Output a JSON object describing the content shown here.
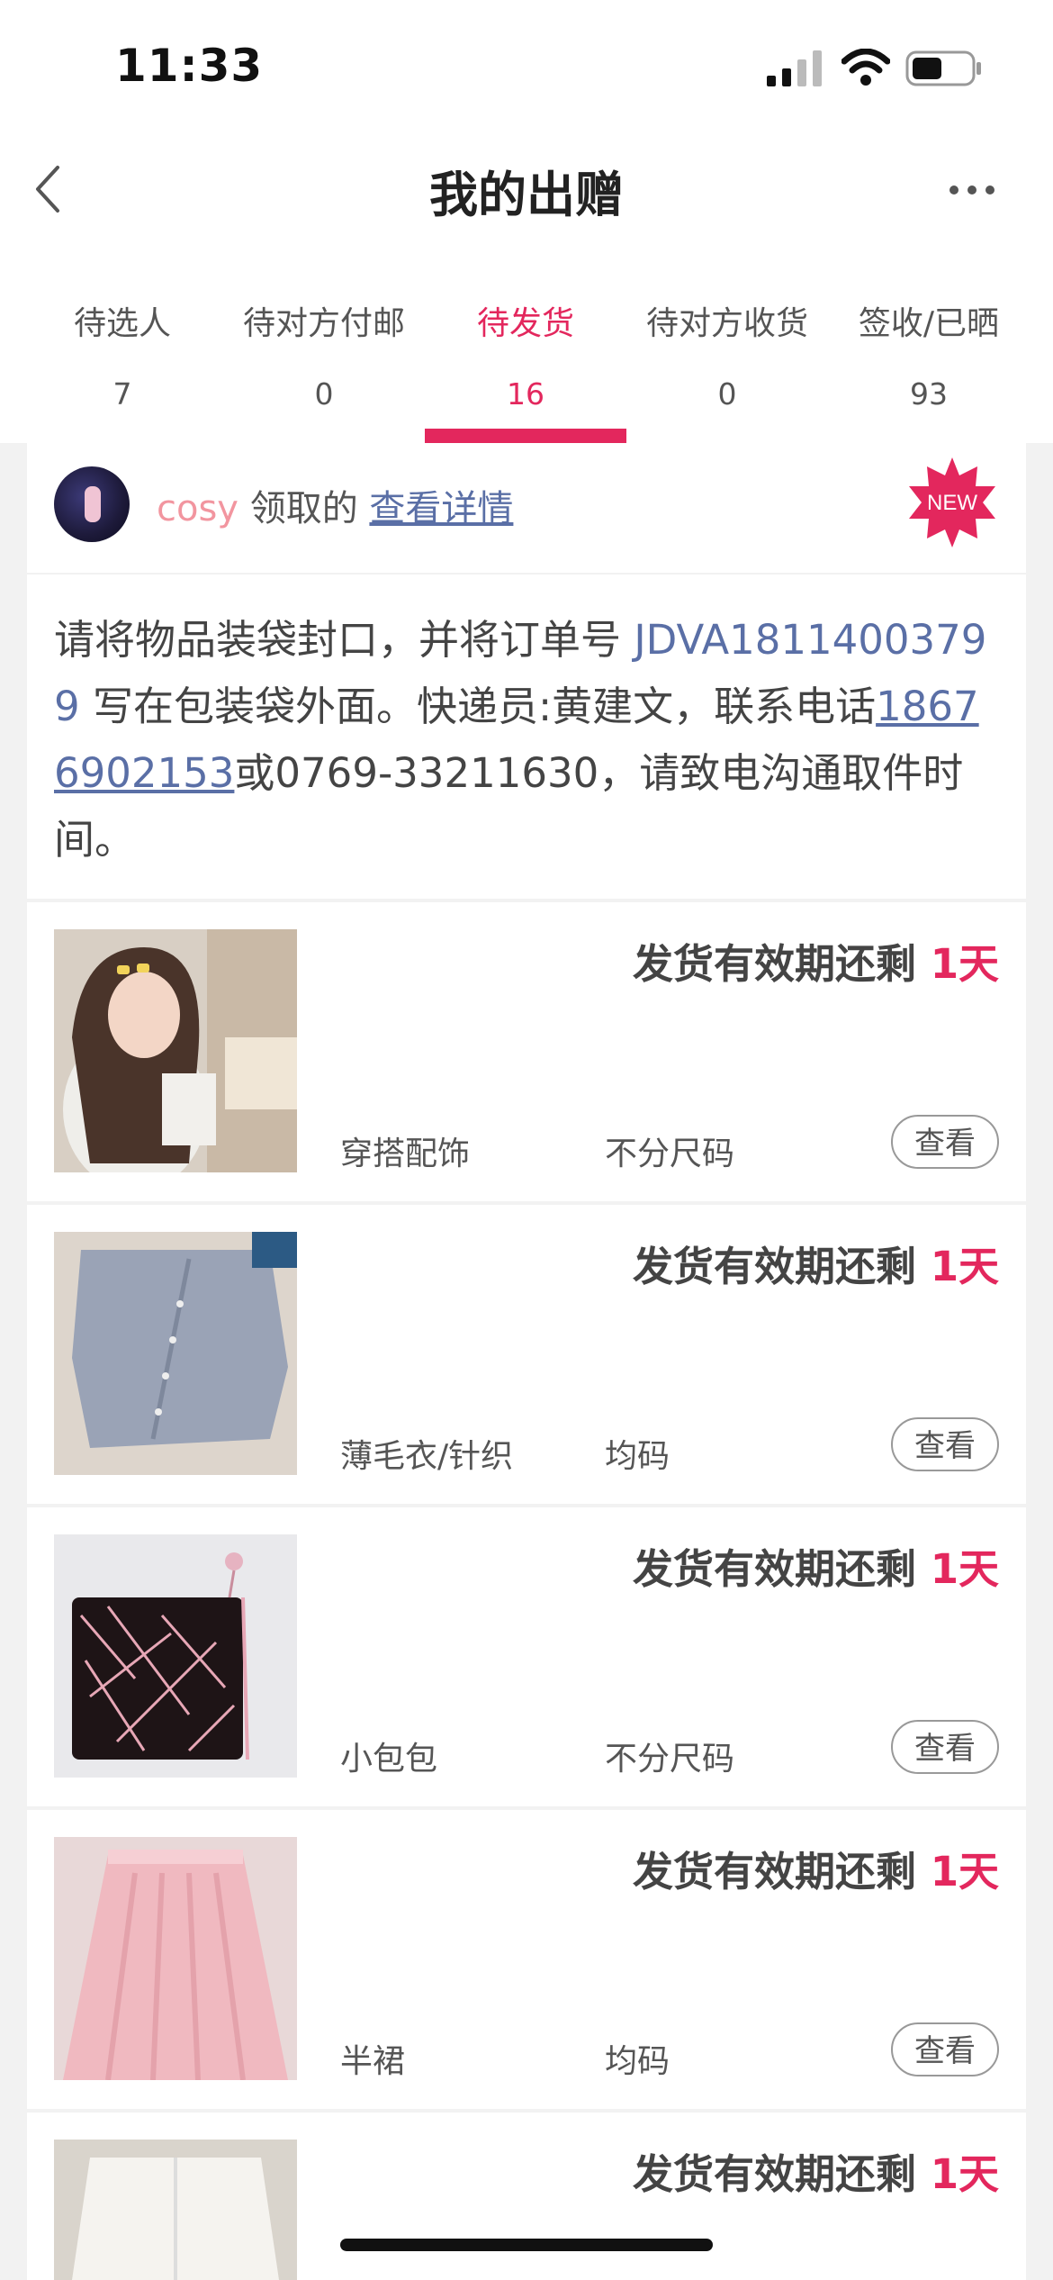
{
  "status_bar": {
    "time": "11:33"
  },
  "header": {
    "title": "我的出赠"
  },
  "tabs": [
    {
      "label": "待选人",
      "count": "7"
    },
    {
      "label": "待对方付邮",
      "count": "0"
    },
    {
      "label": "待发货",
      "count": "16",
      "active": true
    },
    {
      "label": "待对方收货",
      "count": "0"
    },
    {
      "label": "签收/已晒",
      "count": "93"
    }
  ],
  "recipient": {
    "name": "cosy",
    "claimed_text": "领取的",
    "detail_link": "查看详情",
    "badge": "NEW"
  },
  "instructions": {
    "part1": "请将物品装袋封口，并将订单号 ",
    "order_no": "JDVA18114003799",
    "part2": " 写在包装袋外面。快递员:黄建文，联系电话",
    "phone": "18676902153",
    "part3": "或0769-33211630，请致电沟通取件时间。"
  },
  "items": [
    {
      "deadline_prefix": "发货有效期还剩 ",
      "deadline_days": "1天",
      "category": "穿搭配饰",
      "size": "不分尺码",
      "view_label": "查看"
    },
    {
      "deadline_prefix": "发货有效期还剩 ",
      "deadline_days": "1天",
      "category": "薄毛衣/针织",
      "size": "均码",
      "view_label": "查看"
    },
    {
      "deadline_prefix": "发货有效期还剩 ",
      "deadline_days": "1天",
      "category": "小包包",
      "size": "不分尺码",
      "view_label": "查看"
    },
    {
      "deadline_prefix": "发货有效期还剩 ",
      "deadline_days": "1天",
      "category": "半裙",
      "size": "均码",
      "view_label": "查看"
    },
    {
      "deadline_prefix": "发货有效期还剩 ",
      "deadline_days": "1天"
    }
  ],
  "colors": {
    "accent": "#e3275d",
    "link": "#5a6fa6",
    "username": "#f2959f"
  }
}
